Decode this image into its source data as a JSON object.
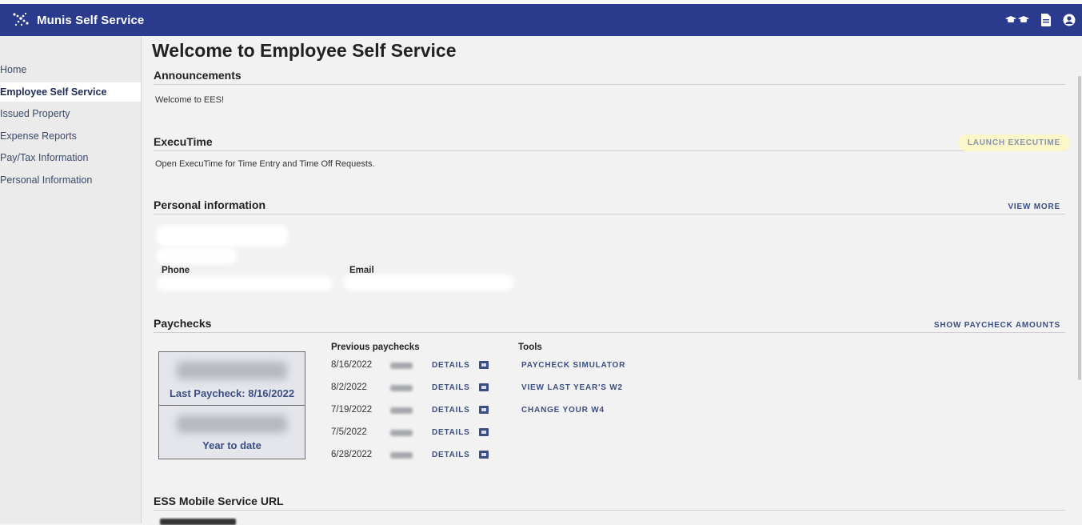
{
  "app": {
    "title": "Munis Self Service",
    "brand_color": "#2a3a8c",
    "icons": [
      "graduation-cap-icon",
      "document-icon",
      "user-circle-icon"
    ]
  },
  "sidebar": {
    "items": [
      {
        "label": "Home",
        "active": false
      },
      {
        "label": "Employee Self Service",
        "active": true
      },
      {
        "label": "Issued Property",
        "active": false
      },
      {
        "label": "Expense Reports",
        "active": false
      },
      {
        "label": "Pay/Tax Information",
        "active": false
      },
      {
        "label": "Personal Information",
        "active": false
      }
    ]
  },
  "main": {
    "title": "Welcome to Employee Self Service",
    "announcements": {
      "heading": "Announcements",
      "text": "Welcome to EES!"
    },
    "executime": {
      "heading": "ExecuTime",
      "action": "LAUNCH EXECUTIME",
      "text": "Open ExecuTime for Time Entry and Time Off Requests."
    },
    "personal": {
      "heading": "Personal information",
      "action": "VIEW MORE",
      "phone_label": "Phone",
      "email_label": "Email"
    },
    "paychecks": {
      "heading": "Paychecks",
      "action": "SHOW PAYCHECK AMOUNTS",
      "last_caption": "Last Paycheck: 8/16/2022",
      "ytd_caption": "Year to date",
      "previous_heading": "Previous paychecks",
      "details_label": "DETAILS",
      "previous": [
        {
          "date": "8/16/2022"
        },
        {
          "date": "8/2/2022"
        },
        {
          "date": "7/19/2022"
        },
        {
          "date": "7/5/2022"
        },
        {
          "date": "6/28/2022"
        }
      ],
      "tools_heading": "Tools",
      "tools": [
        {
          "label": "PAYCHECK SIMULATOR"
        },
        {
          "label": "VIEW LAST YEAR'S W2"
        },
        {
          "label": "CHANGE YOUR W4"
        }
      ]
    },
    "mobile": {
      "heading": "ESS Mobile Service URL"
    }
  }
}
